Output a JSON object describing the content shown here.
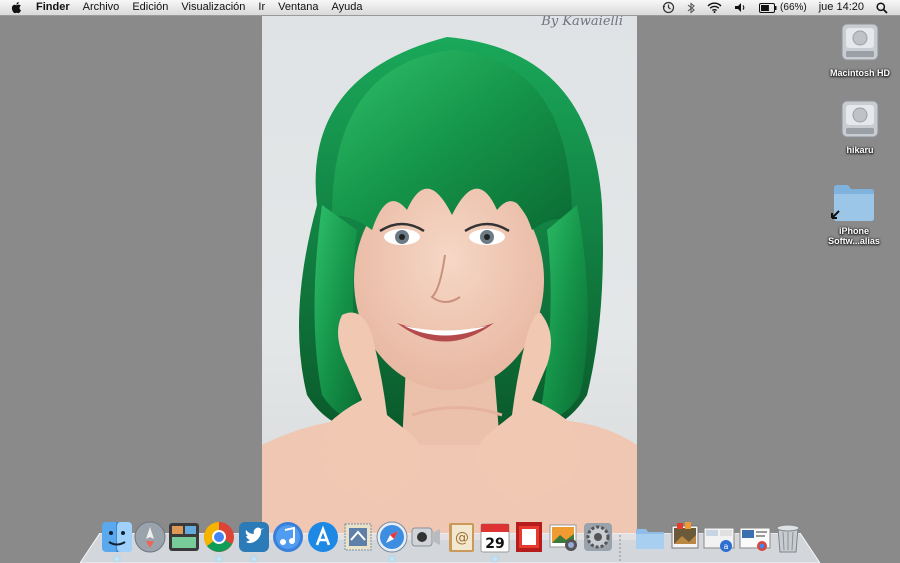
{
  "menubar": {
    "apple_icon": "apple-logo-icon",
    "items": [
      "Finder",
      "Archivo",
      "Edición",
      "Visualización",
      "Ir",
      "Ventana",
      "Ayuda"
    ],
    "status": {
      "time_machine_icon": "time-machine-icon",
      "bluetooth_icon": "bluetooth-icon",
      "wifi_icon": "wifi-icon",
      "volume_icon": "volume-icon",
      "battery_icon": "battery-icon",
      "battery_percent": "(66%)",
      "battery_level": 0.66,
      "clock": "jue 14:20",
      "spotlight_icon": "spotlight-search-icon"
    }
  },
  "wallpaper": {
    "signature": "By Kawaielli",
    "subject": "woman-green-wig-photo"
  },
  "desktop_icons": [
    {
      "label": "Macintosh HD",
      "icon": "hard-drive-icon"
    },
    {
      "label": "hikaru",
      "icon": "hard-drive-icon"
    },
    {
      "label_line1": "iPhone",
      "label_line2": "Softw...alias",
      "icon": "folder-alias-icon"
    }
  ],
  "dock": {
    "apps": [
      "finder-icon",
      "launchpad-icon",
      "mission-control-icon",
      "chrome-icon",
      "twitter-icon",
      "itunes-icon",
      "app-store-icon",
      "mail-stamp-icon",
      "safari-icon",
      "facetime-icon",
      "address-book-icon",
      "ical-icon",
      "photo-booth-icon",
      "iphoto-icon",
      "system-preferences-icon"
    ],
    "calendar_day": "29",
    "stacks": [
      "applications-folder-icon",
      "photos-stack-icon",
      "downloads-stack-icon",
      "documents-stack-icon",
      "trash-icon"
    ],
    "colors": {
      "accent": "#1aa14f",
      "shelf": "#dfe4ea"
    }
  }
}
